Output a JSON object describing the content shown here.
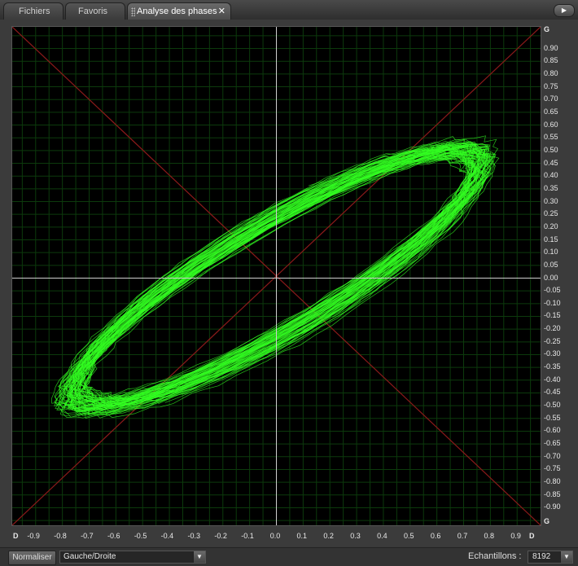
{
  "tabs": [
    {
      "label": "Fichiers",
      "active": false
    },
    {
      "label": "Favoris",
      "active": false
    },
    {
      "label": "Analyse des phases",
      "active": true
    }
  ],
  "icons": {
    "tab_close": "close-icon",
    "panel_menu": "play-arrow-icon",
    "select_arrow": "chevron-down-icon",
    "grip": "grip-icon"
  },
  "axis": {
    "top_label": "G",
    "bottom_label": "G",
    "left_label": "D",
    "right_label": "D",
    "y_ticks": [
      "0.90",
      "0.85",
      "0.80",
      "0.75",
      "0.70",
      "0.65",
      "0.60",
      "0.55",
      "0.50",
      "0.45",
      "0.40",
      "0.35",
      "0.30",
      "0.25",
      "0.20",
      "0.15",
      "0.10",
      "0.05",
      "0.00",
      "-0.05",
      "-0.10",
      "-0.15",
      "-0.20",
      "-0.25",
      "-0.30",
      "-0.35",
      "-0.40",
      "-0.45",
      "-0.50",
      "-0.55",
      "-0.60",
      "-0.65",
      "-0.70",
      "-0.75",
      "-0.80",
      "-0.85",
      "-0.90"
    ],
    "x_ticks": [
      "-0.9",
      "-0.8",
      "-0.7",
      "-0.6",
      "-0.5",
      "-0.4",
      "-0.3",
      "-0.2",
      "-0.1",
      "0.0",
      "0.1",
      "0.2",
      "0.3",
      "0.4",
      "0.5",
      "0.6",
      "0.7",
      "0.8",
      "0.9"
    ]
  },
  "colors": {
    "trace": "#33ff22",
    "diagonal": "#8b1a1a",
    "grid": "#0c3a0c",
    "axis": "#cfcfcf"
  },
  "status": {
    "normalize_label": "Normaliser",
    "channel_mode": "Gauche/Droite",
    "samples_label": "Echantillons :",
    "samples_value": "8192"
  }
}
